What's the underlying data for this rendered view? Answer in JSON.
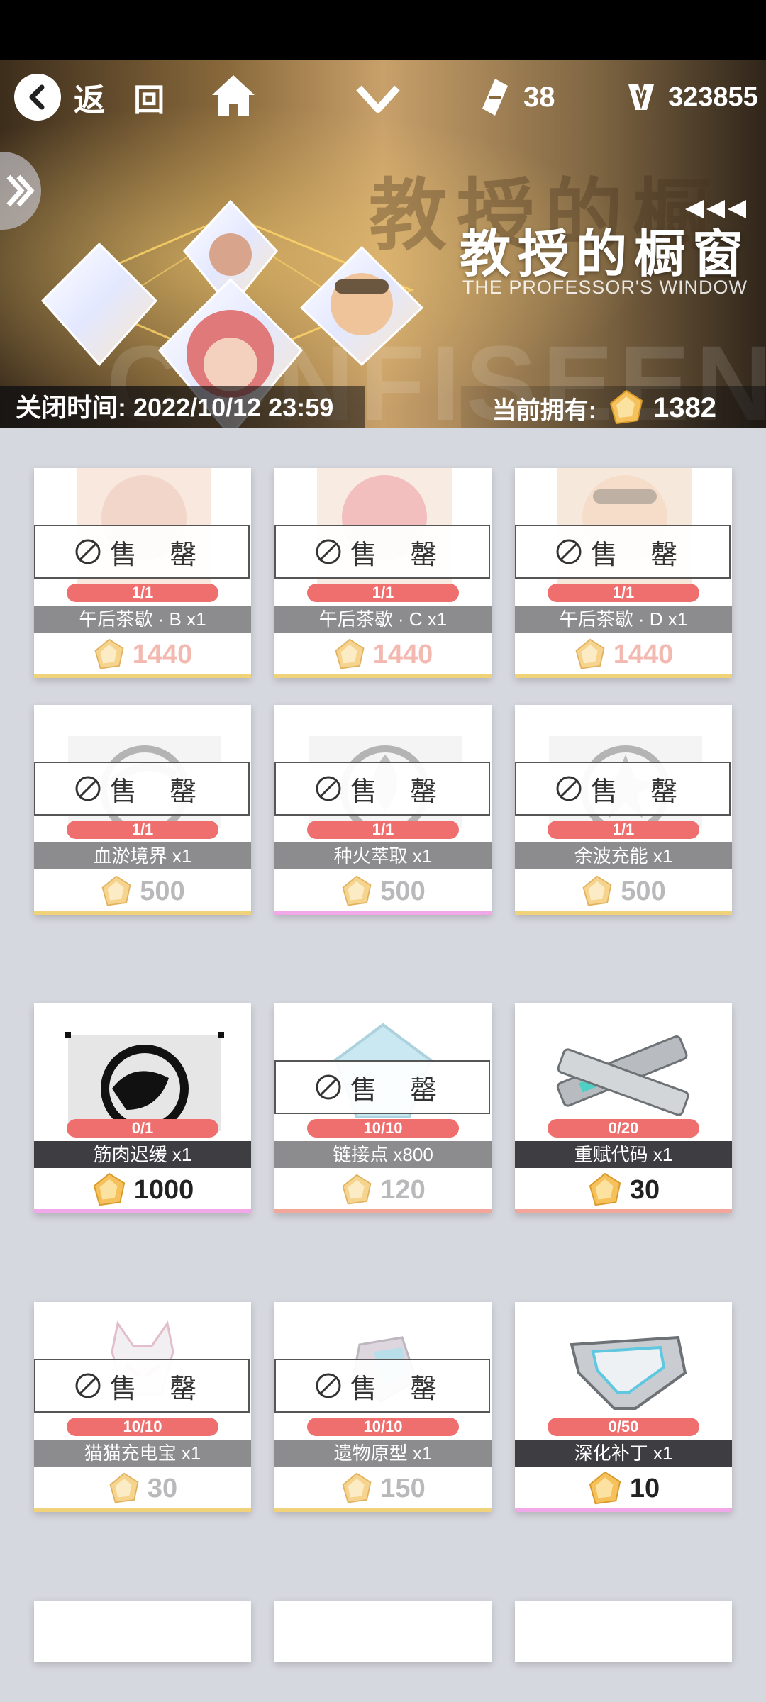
{
  "nav": {
    "back_label": "返 回",
    "ticket_count": "38",
    "currency_amount": "323855"
  },
  "banner": {
    "title_cn": "教授的橱窗",
    "title_en": "THE PROFESSOR'S WINDOW",
    "ghost_text": "教授的橱",
    "ghost_text2": "CONFISEEN",
    "close_time_label": "关闭时间: 2022/10/12 23:59",
    "owned_label": "当前拥有:",
    "owned_amount": "1382"
  },
  "shop": {
    "sold_out_label": "售 罄",
    "items": [
      {
        "name": "午后茶歇 · B x1",
        "stock": "1/1",
        "price": "1440",
        "sold": true
      },
      {
        "name": "午后茶歇 · C x1",
        "stock": "1/1",
        "price": "1440",
        "sold": true
      },
      {
        "name": "午后茶歇 · D x1",
        "stock": "1/1",
        "price": "1440",
        "sold": true
      },
      {
        "name": "血淤境界 x1",
        "stock": "1/1",
        "price": "500",
        "sold": true
      },
      {
        "name": "种火萃取 x1",
        "stock": "1/1",
        "price": "500",
        "sold": true
      },
      {
        "name": "余波充能 x1",
        "stock": "1/1",
        "price": "500",
        "sold": true
      },
      {
        "name": "筋肉迟缓 x1",
        "stock": "0/1",
        "price": "1000",
        "sold": false
      },
      {
        "name": "链接点 x800",
        "stock": "10/10",
        "price": "120",
        "sold": true
      },
      {
        "name": "重赋代码 x1",
        "stock": "0/20",
        "price": "30",
        "sold": false
      },
      {
        "name": "猫猫充电宝 x1",
        "stock": "10/10",
        "price": "30",
        "sold": true
      },
      {
        "name": "遗物原型 x1",
        "stock": "10/10",
        "price": "150",
        "sold": true
      },
      {
        "name": "深化补丁 x1",
        "stock": "0/50",
        "price": "10",
        "sold": false
      }
    ]
  },
  "colors": {
    "accent_gold": "#f0d27a",
    "accent_pink": "#f0a8e8",
    "accent_salmon": "#f2a79a",
    "stock_red": "#ef6f6f"
  }
}
